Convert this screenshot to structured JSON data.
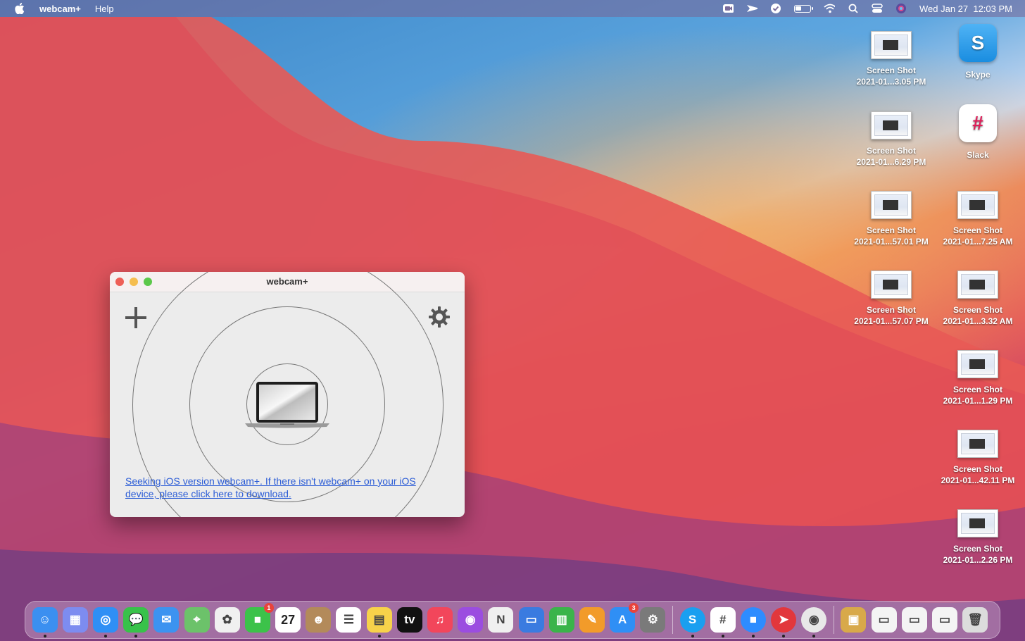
{
  "menubar": {
    "app_name": "webcam+",
    "menus": [
      "Help"
    ],
    "datetime": "Wed Jan 27  12:03 PM",
    "status_icons": [
      "zoom-icon",
      "send-icon",
      "checkmark-icon",
      "battery-icon",
      "wifi-icon",
      "search-icon",
      "control-center-icon",
      "siri-icon"
    ]
  },
  "desktop": {
    "icons": [
      {
        "line1": "Screen Shot",
        "line2": "2021-01...3.05 PM",
        "kind": "screenshot"
      },
      {
        "line1": "Skype",
        "line2": "",
        "kind": "app"
      },
      {
        "line1": "Screen Shot",
        "line2": "2021-01...6.29 PM",
        "kind": "screenshot"
      },
      {
        "line1": "Slack",
        "line2": "",
        "kind": "app"
      },
      {
        "line1": "Screen Shot",
        "line2": "2021-01...57.01 PM",
        "kind": "screenshot"
      },
      {
        "line1": "Screen Shot",
        "line2": "2021-01...7.25 AM",
        "kind": "screenshot"
      },
      {
        "line1": "Screen Shot",
        "line2": "2021-01...57.07 PM",
        "kind": "screenshot"
      },
      {
        "line1": "Screen Shot",
        "line2": "2021-01...3.32 AM",
        "kind": "screenshot"
      },
      {
        "line1": "Screen Shot",
        "line2": "2021-01...1.29 PM",
        "kind": "screenshot"
      },
      {
        "line1": "Screen Shot",
        "line2": "2021-01...42.11 PM",
        "kind": "screenshot"
      },
      {
        "line1": "Screen Shot",
        "line2": "2021-01...2.26 PM",
        "kind": "screenshot"
      }
    ]
  },
  "window": {
    "title": "webcam+",
    "link_text": "Seeking iOS version webcam+. If there isn't webcam+ on your iOS device, please click here to download."
  },
  "dock": {
    "items": [
      {
        "name": "finder-icon",
        "color": "#3b8ff0",
        "glyph": "☺"
      },
      {
        "name": "launchpad-icon",
        "color": "#7d8cf0",
        "glyph": "▦"
      },
      {
        "name": "safari-icon",
        "color": "#2f8ff5",
        "glyph": "◎"
      },
      {
        "name": "messages-icon",
        "color": "#38c24a",
        "glyph": "💬"
      },
      {
        "name": "mail-icon",
        "color": "#3c93f0",
        "glyph": "✉"
      },
      {
        "name": "maps-icon",
        "color": "#6cc26a",
        "glyph": "⌖"
      },
      {
        "name": "photos-icon",
        "color": "#f0f0f0",
        "glyph": "✿"
      },
      {
        "name": "facetime-icon",
        "color": "#3cc24a",
        "glyph": "■",
        "badge": "1"
      },
      {
        "name": "calendar-icon",
        "color": "#ffffff",
        "glyph": "27"
      },
      {
        "name": "contacts-icon",
        "color": "#b38a5a",
        "glyph": "☻"
      },
      {
        "name": "reminders-icon",
        "color": "#ffffff",
        "glyph": "☰"
      },
      {
        "name": "notes-icon",
        "color": "#f7d24a",
        "glyph": "▤"
      },
      {
        "name": "appletv-icon",
        "color": "#111111",
        "glyph": "tv"
      },
      {
        "name": "music-icon",
        "color": "#f2465b",
        "glyph": "♫"
      },
      {
        "name": "podcasts-icon",
        "color": "#9b4de0",
        "glyph": "◉"
      },
      {
        "name": "news-icon",
        "color": "#f0f0f0",
        "glyph": "N"
      },
      {
        "name": "keynote-icon",
        "color": "#3a7be0",
        "glyph": "▭"
      },
      {
        "name": "numbers-icon",
        "color": "#3ab44a",
        "glyph": "▥"
      },
      {
        "name": "pages-icon",
        "color": "#f29b2a",
        "glyph": "✎"
      },
      {
        "name": "appstore-icon",
        "color": "#2f8ff5",
        "glyph": "A",
        "badge": "3"
      },
      {
        "name": "system-preferences-icon",
        "color": "#7a7a7a",
        "glyph": "⚙"
      },
      {
        "name": "skype-icon",
        "color": "#1a9ff0",
        "glyph": "S"
      },
      {
        "name": "slack-icon",
        "color": "#ffffff",
        "glyph": "#"
      },
      {
        "name": "zoom-icon",
        "color": "#2d8cff",
        "glyph": "■"
      },
      {
        "name": "airmail-icon",
        "color": "#e2373c",
        "glyph": "➤"
      },
      {
        "name": "webcam-plus-icon",
        "color": "#e8e8e8",
        "glyph": "◉"
      },
      {
        "name": "archive-utility-icon",
        "color": "#d8a94a",
        "glyph": "▣"
      },
      {
        "name": "recent-screenshot-1-icon",
        "color": "#f4f4f4",
        "glyph": "▭"
      },
      {
        "name": "recent-screenshot-2-icon",
        "color": "#f4f4f4",
        "glyph": "▭"
      },
      {
        "name": "recent-screenshot-3-icon",
        "color": "#f4f4f4",
        "glyph": "▭"
      },
      {
        "name": "trash-icon",
        "color": "#dcdcdc",
        "glyph": "🗑"
      }
    ]
  }
}
